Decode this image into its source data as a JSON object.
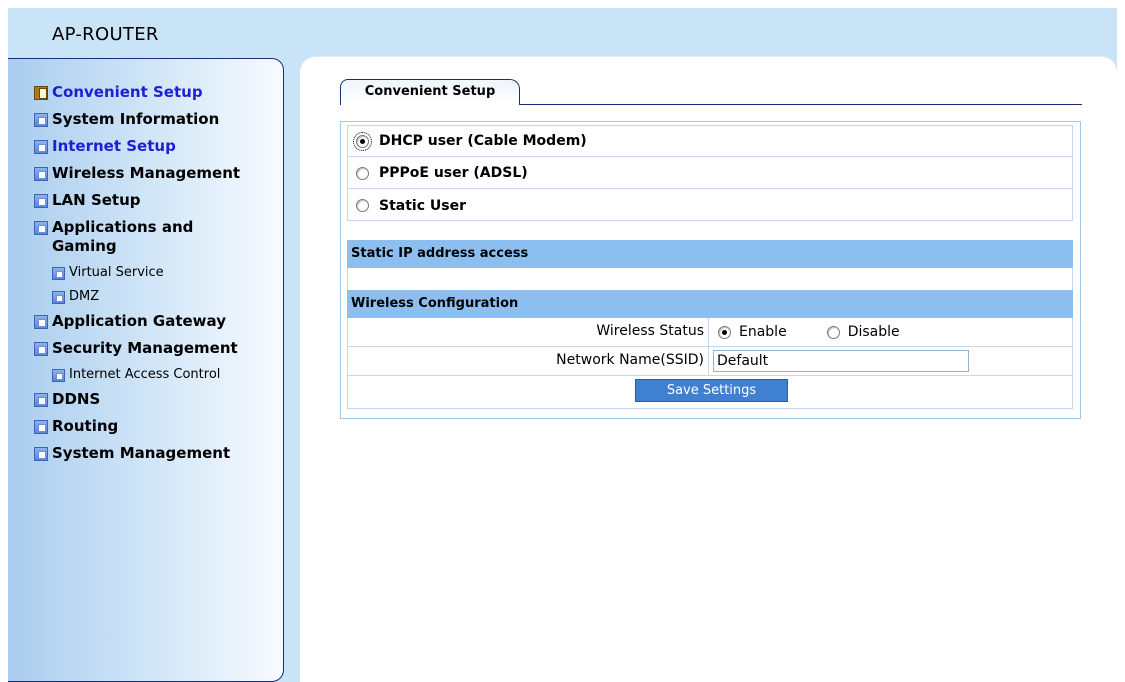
{
  "app": {
    "title": "AP-ROUTER"
  },
  "sidebar": {
    "items": [
      {
        "label": "Convenient Setup",
        "icon": "folder-open-icon"
      },
      {
        "label": "System Information",
        "icon": "page-icon"
      },
      {
        "label": "Internet Setup",
        "icon": "page-icon"
      },
      {
        "label": "Wireless Management",
        "icon": "page-icon"
      },
      {
        "label": "LAN Setup",
        "icon": "page-icon"
      },
      {
        "label": "Applications and Gaming",
        "icon": "page-icon"
      },
      {
        "label": "Virtual Service",
        "icon": "page-icon"
      },
      {
        "label": "DMZ",
        "icon": "page-icon"
      },
      {
        "label": "Application Gateway",
        "icon": "page-icon"
      },
      {
        "label": "Security Management",
        "icon": "page-icon"
      },
      {
        "label": "Internet Access Control",
        "icon": "page-icon"
      },
      {
        "label": "DDNS",
        "icon": "page-icon"
      },
      {
        "label": "Routing",
        "icon": "page-icon"
      },
      {
        "label": "System Management",
        "icon": "page-icon"
      }
    ]
  },
  "main": {
    "tab": "Convenient Setup",
    "connection_options": [
      {
        "label": "DHCP user (Cable Modem)",
        "checked": true
      },
      {
        "label": "PPPoE user (ADSL)",
        "checked": false
      },
      {
        "label": "Static User",
        "checked": false
      }
    ],
    "static_section_title": "Static IP address access",
    "wireless_section_title": "Wireless Configuration",
    "wireless_status_label": "Wireless Status",
    "wireless_status_enable": "Enable",
    "wireless_status_disable": "Disable",
    "wireless_status_value": "Enable",
    "ssid_label": "Network Name(SSID)",
    "ssid_value": "Default",
    "save_button": "Save Settings"
  },
  "colors": {
    "header_bg": "#c9e3f7",
    "section_header": "#8cbff0",
    "button": "#3f80d2",
    "active_link": "#1f1fd2"
  }
}
